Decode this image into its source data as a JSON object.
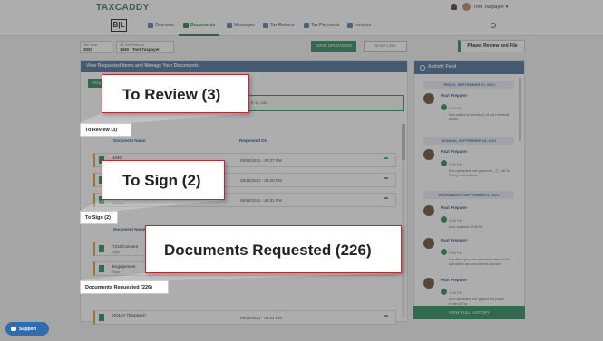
{
  "app": {
    "logo": "TAXCADDY",
    "brand_logo": "B|L",
    "user": "Tom Taxpayer ▾"
  },
  "nav": [
    {
      "label": "Overview",
      "active": false
    },
    {
      "label": "Documents",
      "active": true
    },
    {
      "label": "Messages",
      "active": false
    },
    {
      "label": "Tax Returns",
      "active": false
    },
    {
      "label": "Tax Payments",
      "active": false
    },
    {
      "label": "Invoices",
      "active": false
    }
  ],
  "filters": {
    "year_label": "Tax Year",
    "year_value": "2020",
    "return_label": "All Tax Returns",
    "return_value": "1040 - Tom Taxpayer"
  },
  "actions": {
    "done_uploading": "DONE UPLOADING",
    "smart_links": "Smart Links",
    "phase": "Phase: Review and File"
  },
  "main": {
    "header": "View Requested Items and Manage Your Documents",
    "upload_button": "Req",
    "info_text": "like W-2s, 1099s, 1098s, Schedule K-1s, etc.",
    "col_name": "Document Name",
    "col_date": "Requested On",
    "rows": [
      {
        "name": "1040",
        "sub": "Review",
        "date": "08/10/2021 - 03:27 PM"
      },
      {
        "name": "",
        "sub": "",
        "date": "08/10/2021 - 03:29 PM"
      },
      {
        "name": "",
        "sub": "Review",
        "date": "08/10/2021 - 03:31 PM"
      },
      {
        "name": "7216 Consent",
        "sub": "Sign",
        "date": ""
      },
      {
        "name": "Engagement",
        "sub": "Sign",
        "date": ""
      },
      {
        "name": "HOLLY (Taxpayer)",
        "sub": "",
        "date": "08/10/2021 - 03:21 PM"
      }
    ]
  },
  "feed": {
    "title": "Activity Feed",
    "days": [
      "FRIDAY, SEPTEMBER 17, 2021",
      "MONDAY, SEPTEMBER 13, 2021",
      "WEDNESDAY, SEPTEMBER 8, 2021"
    ],
    "items": [
      {
        "person": "Paul Preparer",
        "time": "4:08 PM",
        "msg": "has added a summary of your federal return."
      },
      {
        "person": "Paul Preparer",
        "time": "3:25 PM",
        "msg": "has uploaded test payment _2_.pdf to Filing Instructions"
      },
      {
        "person": "Paul Preparer",
        "time": "3:08 PM",
        "msg": "has updated 1040 EL"
      },
      {
        "person": "Paul Preparer",
        "time": "3:08 PM",
        "msg": "has filled your tax questionnaire to the uploaded tax documents section."
      },
      {
        "person": "Paul Preparer",
        "time": "3:08 PM",
        "msg": "has uploaded test payment1.pdf to Federal Tax"
      }
    ],
    "view_history": "VIEW FULL HISTORY"
  },
  "callouts": {
    "review": "To Review  (3)",
    "sign": "To Sign  (2)",
    "docs": "Documents Requested  (226)",
    "mini_review": "To Review  (3)",
    "mini_sign": "To Sign  (2)",
    "mini_docs": "Documents Requested  (226)"
  },
  "support": "Support"
}
